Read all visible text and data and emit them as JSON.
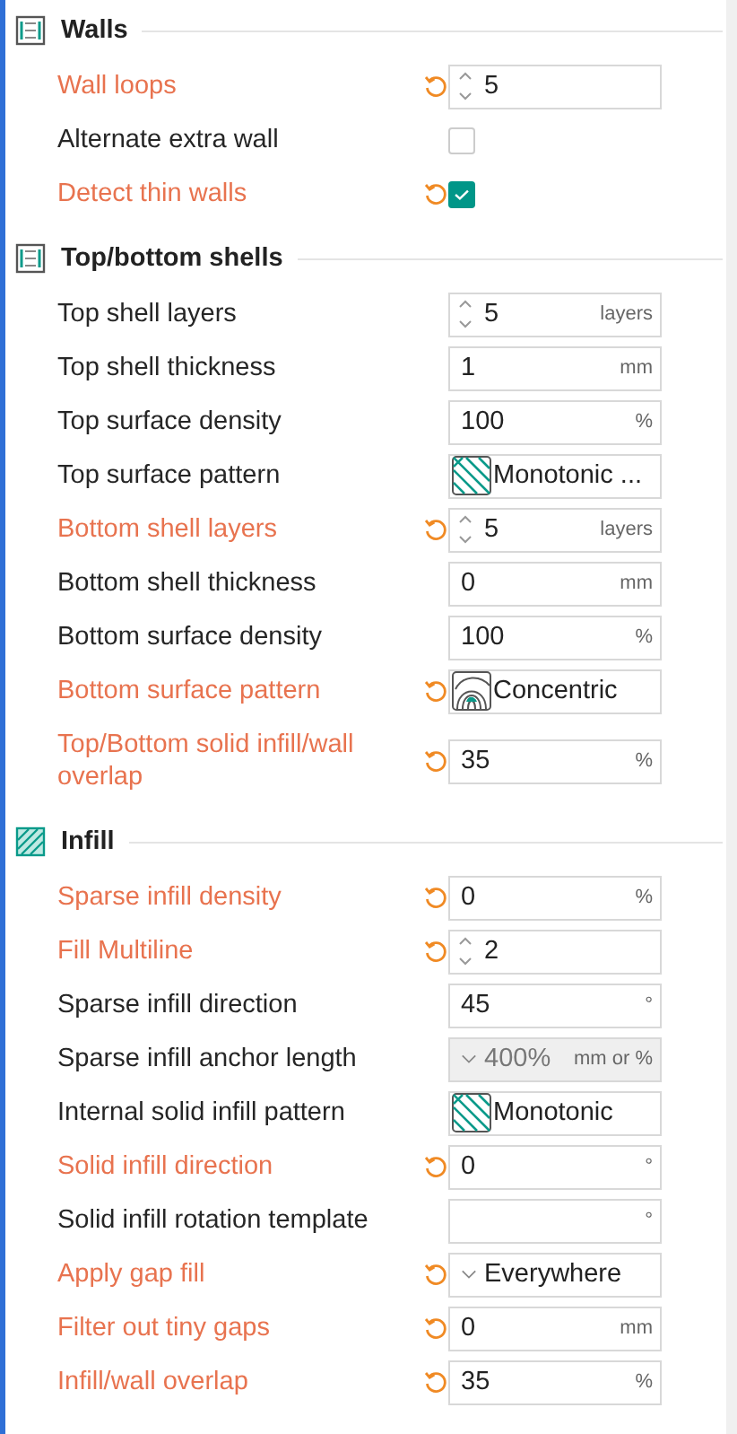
{
  "sections": [
    {
      "title": "Walls",
      "kind": "frame",
      "rows": [
        {
          "label": "Wall loops",
          "modified": true,
          "kind": "spin",
          "value": "5"
        },
        {
          "label": "Alternate extra wall",
          "modified": false,
          "kind": "check",
          "checked": false
        },
        {
          "label": "Detect thin walls",
          "modified": true,
          "kind": "check",
          "checked": true
        }
      ]
    },
    {
      "title": "Top/bottom shells",
      "kind": "frame",
      "rows": [
        {
          "label": "Top shell layers",
          "modified": false,
          "kind": "spin",
          "value": "5",
          "unit": "layers"
        },
        {
          "label": "Top shell thickness",
          "modified": false,
          "kind": "number",
          "value": "1",
          "unit": "mm"
        },
        {
          "label": "Top surface density",
          "modified": false,
          "kind": "number",
          "value": "100",
          "unit": "%"
        },
        {
          "label": "Top surface pattern",
          "modified": false,
          "kind": "pattern-lines",
          "value": "Monotonic ..."
        },
        {
          "label": "Bottom shell layers",
          "modified": true,
          "kind": "spin",
          "value": "5",
          "unit": "layers"
        },
        {
          "label": "Bottom shell thickness",
          "modified": false,
          "kind": "number",
          "value": "0",
          "unit": "mm"
        },
        {
          "label": "Bottom surface density",
          "modified": false,
          "kind": "number",
          "value": "100",
          "unit": "%"
        },
        {
          "label": "Bottom surface pattern",
          "modified": true,
          "kind": "pattern-rings",
          "value": "Concentric"
        },
        {
          "label": "Top/Bottom solid infill/wall overlap",
          "modified": true,
          "kind": "number",
          "value": "35",
          "unit": "%"
        }
      ]
    },
    {
      "title": "Infill",
      "kind": "hatch",
      "rows": [
        {
          "label": "Sparse infill density",
          "modified": true,
          "kind": "number",
          "value": "0",
          "unit": "%"
        },
        {
          "label": "Fill Multiline",
          "modified": true,
          "kind": "spin",
          "value": "2"
        },
        {
          "label": "Sparse infill direction",
          "modified": false,
          "kind": "number",
          "value": "45",
          "unit": "°"
        },
        {
          "label": "Sparse infill anchor length",
          "modified": false,
          "kind": "dropdown",
          "value": "400%",
          "unit": "mm or %",
          "disabled": true
        },
        {
          "label": "Internal solid infill pattern",
          "modified": false,
          "kind": "pattern-lines",
          "value": "Monotonic"
        },
        {
          "label": "Solid infill direction",
          "modified": true,
          "kind": "number",
          "value": "0",
          "unit": "°"
        },
        {
          "label": "Solid infill rotation template",
          "modified": false,
          "kind": "number",
          "unit": "°"
        },
        {
          "label": "Apply gap fill",
          "modified": true,
          "kind": "dropdown",
          "value": "Everywhere",
          "disabled": false
        },
        {
          "label": "Filter out tiny gaps",
          "modified": true,
          "kind": "number",
          "value": "0",
          "unit": "mm"
        },
        {
          "label": "Infill/wall overlap",
          "modified": true,
          "kind": "number",
          "value": "35",
          "unit": "%"
        }
      ]
    }
  ]
}
